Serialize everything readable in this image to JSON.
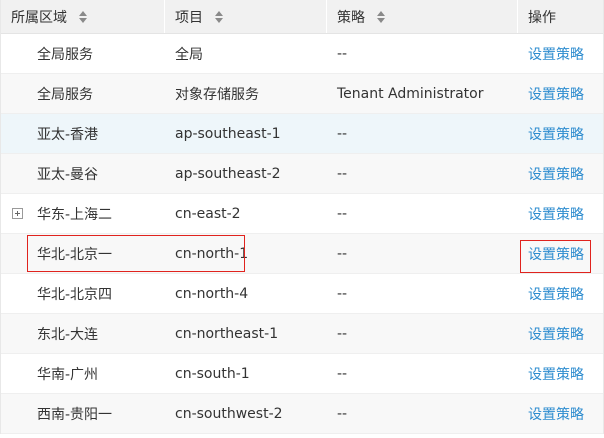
{
  "table": {
    "headers": {
      "region": "所属区域",
      "project": "项目",
      "policy": "策略",
      "action": "操作"
    },
    "rows": [
      {
        "region": "全局服务",
        "project": "全局",
        "policy": "--",
        "action": "设置策略"
      },
      {
        "region": "全局服务",
        "project": "对象存储服务",
        "policy": "Tenant Administrator",
        "action": "设置策略"
      },
      {
        "region": "亚太-香港",
        "project": "ap-southeast-1",
        "policy": "--",
        "action": "设置策略"
      },
      {
        "region": "亚太-曼谷",
        "project": "ap-southeast-2",
        "policy": "--",
        "action": "设置策略"
      },
      {
        "region": "华东-上海二",
        "project": "cn-east-2",
        "policy": "--",
        "action": "设置策略"
      },
      {
        "region": "华北-北京一",
        "project": "cn-north-1",
        "policy": "--",
        "action": "设置策略"
      },
      {
        "region": "华北-北京四",
        "project": "cn-north-4",
        "policy": "--",
        "action": "设置策略"
      },
      {
        "region": "东北-大连",
        "project": "cn-northeast-1",
        "policy": "--",
        "action": "设置策略"
      },
      {
        "region": "华南-广州",
        "project": "cn-south-1",
        "policy": "--",
        "action": "设置策略"
      },
      {
        "region": "西南-贵阳一",
        "project": "cn-southwest-2",
        "policy": "--",
        "action": "设置策略"
      }
    ]
  },
  "colors": {
    "link": "#2d8ccf",
    "highlight_box": "#e0231e",
    "header_bg": "#f1f1f1"
  }
}
